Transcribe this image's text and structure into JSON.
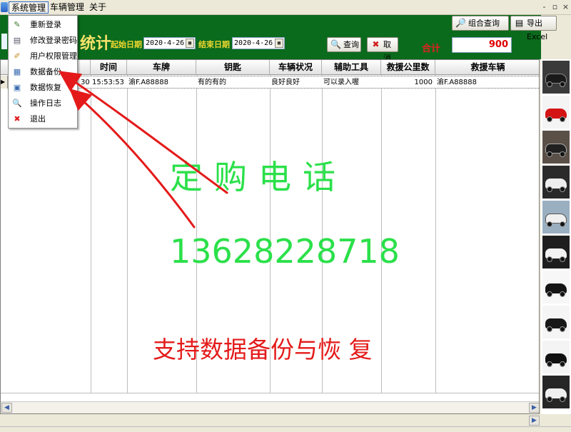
{
  "menubar": {
    "items": [
      "系统管理",
      "车辆管理",
      "关于"
    ],
    "window_controls": [
      "-",
      "▫",
      "×"
    ]
  },
  "header": {
    "title_fragment": "统计",
    "start_label": "起始日期",
    "start_date": "2020-4-26",
    "end_label": "结束日期",
    "end_date": "2020-4-26",
    "query_label": "查询",
    "cancel_label": "取消",
    "combo_query_label": "组合查询",
    "export_label": "导出Excel",
    "total_label": "合计",
    "total_value": "900"
  },
  "grid": {
    "columns": [
      "",
      "时间",
      "车牌",
      "钥匙",
      "车辆状况",
      "辅助工具",
      "救援公里数",
      "救援车辆"
    ],
    "row": {
      "date_frag": "30",
      "time": "15:53:53",
      "plate": "渝F.A88888",
      "key": "有的有的",
      "status": "良好良好",
      "tools": "可以录入喔",
      "km": "1000",
      "rescue_vehicle": "渝F.A88888"
    }
  },
  "dropdown": {
    "items": [
      {
        "label": "重新登录",
        "icon": "relogin-icon"
      },
      {
        "label": "修改登录密码",
        "icon": "password-icon"
      },
      {
        "label": "用户权限管理",
        "icon": "permission-icon"
      },
      {
        "label": "数据备份",
        "icon": "backup-icon"
      },
      {
        "label": "数据恢复",
        "icon": "restore-icon"
      },
      {
        "label": "操作日志",
        "icon": "log-icon"
      },
      {
        "label": "退出",
        "icon": "exit-icon"
      }
    ]
  },
  "overlay": {
    "line1": "定购电话",
    "phone": "13628228718",
    "line3": "支持数据备份与恢 复"
  },
  "colors": {
    "header_green": "#0A6B1C",
    "overlay_green": "#2BE04A",
    "overlay_red": "#E41A1A",
    "total_red": "#E00000"
  }
}
